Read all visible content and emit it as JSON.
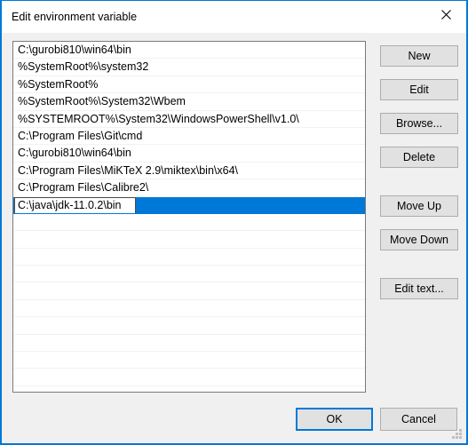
{
  "window": {
    "title": "Edit environment variable",
    "close_icon": "close-icon",
    "accent_color": "#0078d7",
    "background_color": "#f0f0f0"
  },
  "list": {
    "items": [
      "C:\\gurobi810\\win64\\bin",
      "%SystemRoot%\\system32",
      "%SystemRoot%",
      "%SystemRoot%\\System32\\Wbem",
      "%SYSTEMROOT%\\System32\\WindowsPowerShell\\v1.0\\",
      "C:\\Program Files\\Git\\cmd",
      "C:\\gurobi810\\win64\\bin",
      "C:\\Program Files\\MiKTeX 2.9\\miktex\\bin\\x64\\",
      "C:\\Program Files\\Calibre2\\"
    ],
    "selected_index": 9,
    "selected_value": "C:\\java\\jdk-11.0.2\\bin",
    "selection_color": "#0078d7",
    "empty_row_count": 11
  },
  "side_buttons": {
    "new": "New",
    "edit": "Edit",
    "browse": "Browse...",
    "delete": "Delete",
    "move_up": "Move Up",
    "move_down": "Move Down",
    "edit_text": "Edit text..."
  },
  "bottom_buttons": {
    "ok": "OK",
    "cancel": "Cancel"
  },
  "resize_grip": "resize-grip-icon"
}
